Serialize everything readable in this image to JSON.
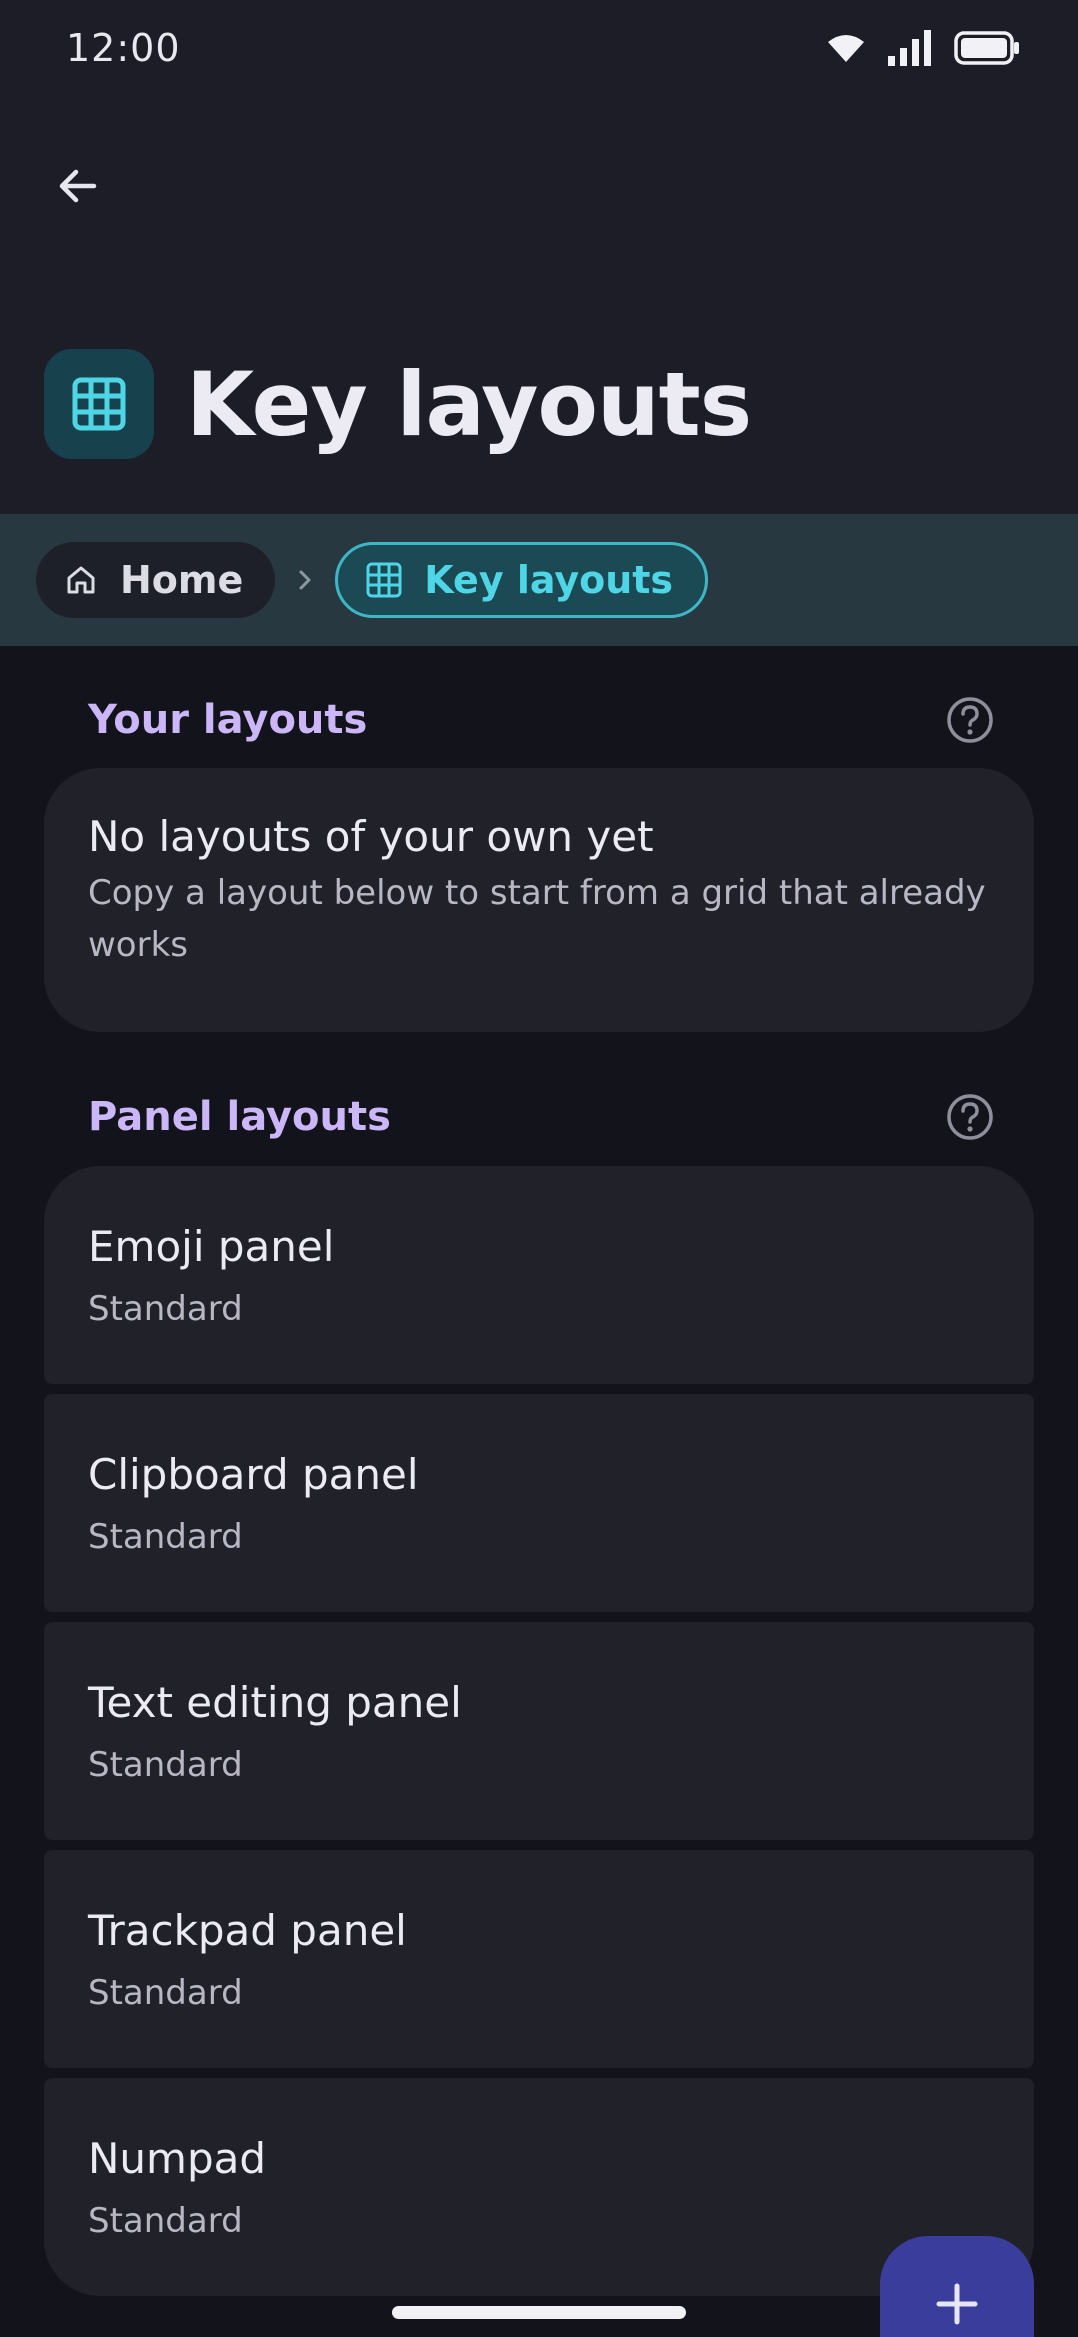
{
  "status_bar": {
    "time": "12:00",
    "icons": [
      "wifi-icon",
      "signal-icon",
      "battery-icon"
    ]
  },
  "header": {
    "back_icon": "arrow-left-icon",
    "title": "Key layouts",
    "title_icon": "grid-icon"
  },
  "breadcrumb": {
    "items": [
      {
        "label": "Home",
        "icon": "home-icon"
      },
      {
        "label": "Key layouts",
        "icon": "grid-icon"
      }
    ],
    "separator_icon": "chevron-right-icon"
  },
  "sections": [
    {
      "title": "Your layouts",
      "help_icon": "help-circle-icon",
      "empty_title": "No layouts of your own yet",
      "empty_message": "Copy a layout below to start from a grid that already works"
    },
    {
      "title": "Panel layouts",
      "help_icon": "help-circle-icon",
      "items": [
        {
          "title": "Emoji panel",
          "subtitle": "Standard"
        },
        {
          "title": "Clipboard panel",
          "subtitle": "Standard"
        },
        {
          "title": "Text editing panel",
          "subtitle": "Standard"
        },
        {
          "title": "Trackpad panel",
          "subtitle": "Standard"
        },
        {
          "title": "Numpad",
          "subtitle": "Standard"
        }
      ]
    }
  ],
  "fab": {
    "icon": "plus-icon"
  },
  "colors": {
    "background": "#13131b",
    "header": "#1c1d27",
    "breadcrumb_bar": "#273840",
    "accent_cyan": "#4fd6e6",
    "section_title": "#cbb6f7",
    "card": "#212129",
    "fab": "#3b3d9c"
  }
}
